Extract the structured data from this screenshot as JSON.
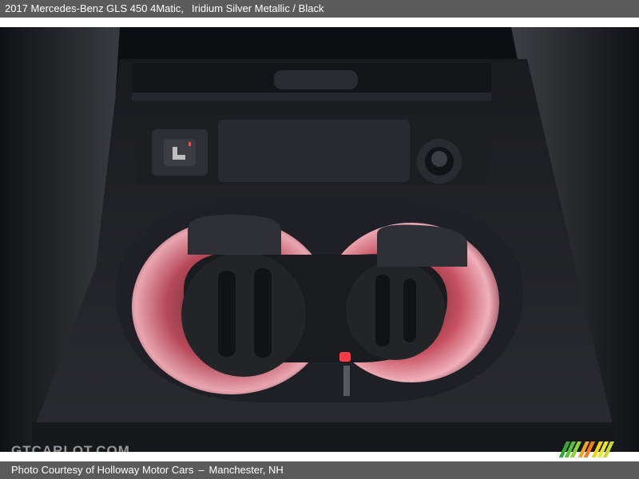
{
  "header": {
    "vehicle": "2017 Mercedes-Benz GLS 450 4Matic,",
    "color": "Iridium Silver Metallic / Black"
  },
  "watermark": {
    "text": "GTCARLOT.COM"
  },
  "footer": {
    "credit": "Photo Courtesy of Holloway Motor Cars",
    "location": "Manchester, NH"
  },
  "colors": {
    "bar_background": "#5b5b5b",
    "ambient_red": "#e0505f",
    "console_dark": "#1b1c20"
  },
  "icons": {
    "seat_heat_button": "seat-heat-icon",
    "stripe_logo": "color-stripes-logo"
  }
}
